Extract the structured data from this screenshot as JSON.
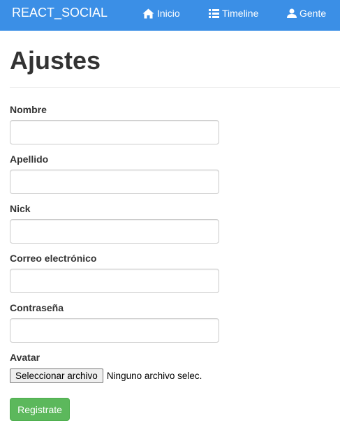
{
  "navbar": {
    "brand": "REACT_SOCIAL",
    "items": [
      {
        "label": "Inicio",
        "icon": "home-icon"
      },
      {
        "label": "Timeline",
        "icon": "list-icon"
      },
      {
        "label": "Gente",
        "icon": "user-icon"
      }
    ],
    "background": "#3b8fe6"
  },
  "page": {
    "title": "Ajustes"
  },
  "form": {
    "fields": [
      {
        "label": "Nombre",
        "value": ""
      },
      {
        "label": "Apellido",
        "value": ""
      },
      {
        "label": "Nick",
        "value": ""
      },
      {
        "label": "Correo electrónico",
        "value": ""
      },
      {
        "label": "Contraseña",
        "value": ""
      }
    ],
    "avatar": {
      "label": "Avatar",
      "button_label": "Seleccionar archivo",
      "status": "Ninguno archivo selec."
    },
    "submit_label": "Registrate",
    "submit_color": "#5cb85c"
  }
}
